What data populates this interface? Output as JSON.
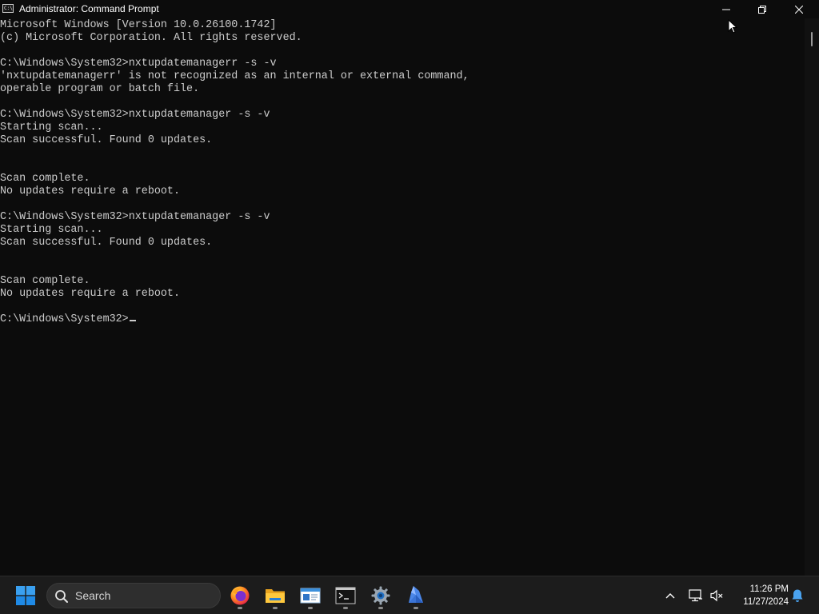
{
  "window": {
    "title": "Administrator: Command Prompt",
    "app_icon_text": "C:\\",
    "controls": {
      "minimize_icon": "minimize-icon",
      "maximize_icon": "restore-icon",
      "close_icon": "close-icon"
    }
  },
  "console": {
    "text_color": "#cccccc",
    "background": "#0c0c0c",
    "lines": [
      "Microsoft Windows [Version 10.0.26100.1742]",
      "(c) Microsoft Corporation. All rights reserved.",
      "",
      "C:\\Windows\\System32>nxtupdatemanagerr -s -v",
      "'nxtupdatemanagerr' is not recognized as an internal or external command,",
      "operable program or batch file.",
      "",
      "C:\\Windows\\System32>nxtupdatemanager -s -v",
      "Starting scan...",
      "Scan successful. Found 0 updates.",
      "",
      "",
      "Scan complete.",
      "No updates require a reboot.",
      "",
      "C:\\Windows\\System32>nxtupdatemanager -s -v",
      "Starting scan...",
      "Scan successful. Found 0 updates.",
      "",
      "",
      "Scan complete.",
      "No updates require a reboot.",
      "",
      "C:\\Windows\\System32>"
    ]
  },
  "taskbar": {
    "search_label": "Search",
    "apps": [
      {
        "name": "firefox",
        "icon": "firefox-icon"
      },
      {
        "name": "file-explorer",
        "icon": "folder-icon"
      },
      {
        "name": "notepad",
        "icon": "notepad-icon"
      },
      {
        "name": "command-prompt",
        "icon": "terminal-icon"
      },
      {
        "name": "settings",
        "icon": "gear-icon"
      },
      {
        "name": "app",
        "icon": "crystal-icon"
      }
    ],
    "clock": {
      "time": "11:26 PM",
      "date": "11/27/2024"
    },
    "accent": "#0078d4"
  }
}
